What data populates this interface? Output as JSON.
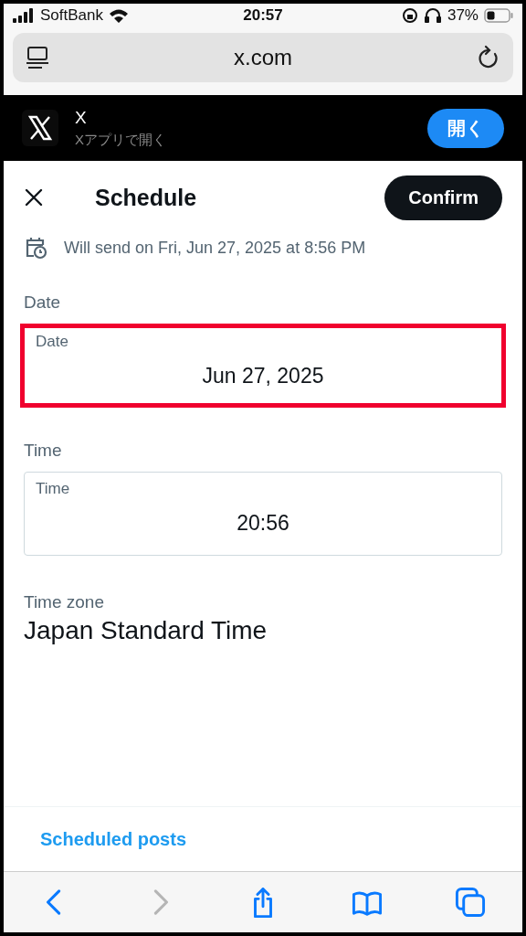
{
  "status_bar": {
    "carrier": "SoftBank",
    "time": "20:57",
    "battery": "37%"
  },
  "address_bar": {
    "url": "x.com"
  },
  "app_banner": {
    "name": "X",
    "subtitle": "Xアプリで開く",
    "button": "開く"
  },
  "header": {
    "title": "Schedule",
    "confirm": "Confirm"
  },
  "summary": "Will send on Fri, Jun 27, 2025 at 8:56 PM",
  "fields": [
    {
      "section": "Date",
      "label": "Date",
      "value": "Jun 27, 2025",
      "highlighted": true
    },
    {
      "section": "Time",
      "label": "Time",
      "value": "20:56",
      "highlighted": false
    }
  ],
  "time_zone": {
    "label": "Time zone",
    "value": "Japan Standard Time"
  },
  "scheduled_link": "Scheduled posts",
  "toolbar": [
    {
      "kind": "back",
      "disabled": false
    },
    {
      "kind": "forward",
      "disabled": true
    },
    {
      "kind": "share",
      "disabled": false
    },
    {
      "kind": "bookmarks",
      "disabled": false
    },
    {
      "kind": "tabs",
      "disabled": false
    }
  ]
}
